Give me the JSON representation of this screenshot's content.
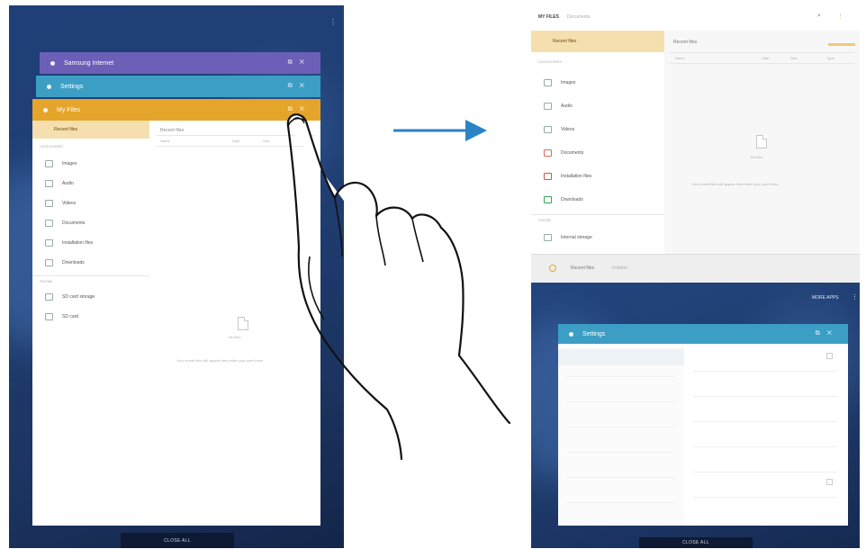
{
  "left_tablet": {
    "windows": [
      {
        "title": "Samsung Internet",
        "color": "#6b5fb8"
      },
      {
        "title": "Settings",
        "color": "#3c9ec4"
      },
      {
        "title": "My Files",
        "color": "#e5a52b"
      }
    ],
    "my_files": {
      "selected": "Recent files",
      "section_label": "CATEGORIES",
      "categories": [
        "Images",
        "Audio",
        "Videos",
        "Documents",
        "Installation files",
        "Downloads"
      ],
      "storage_label": "PHONE",
      "storage": [
        "SD card storage",
        "SD card"
      ],
      "content_header": "Recent files",
      "columns": [
        "Name",
        "Date",
        "Size"
      ],
      "empty_title": "No files",
      "empty_hint": "Your recent files will appear here when you open them."
    },
    "close_all": "CLOSE ALL"
  },
  "right_tablet": {
    "top_tabs": [
      "MY FILES",
      "Documents"
    ],
    "my_files": {
      "selected": "Recent files",
      "section_label": "CATEGORIES",
      "categories": [
        "Images",
        "Audio",
        "Videos",
        "Documents",
        "Installation files",
        "Downloads"
      ],
      "storage_label": "PHONE",
      "storage": [
        "Internal storage"
      ],
      "content_header": "Recent files",
      "columns": [
        "Name",
        "Date",
        "Size",
        "Type"
      ],
      "empty_title": "No files",
      "empty_hint": "Your recent files will appear here when you open them."
    },
    "collapsed_bar": [
      "Recent files",
      "Folders"
    ],
    "bottom_right_label": "MORE APPS",
    "settings_window": {
      "title": "Settings"
    },
    "close_all": "CLOSE ALL"
  },
  "colors": {
    "wallpaper": "#203f74",
    "arrow": "#2b83c6",
    "internet_bar": "#6b5fb8",
    "settings_bar": "#3c9ec4",
    "myfiles_bar": "#e5a52b",
    "selection": "#f6dfae"
  }
}
